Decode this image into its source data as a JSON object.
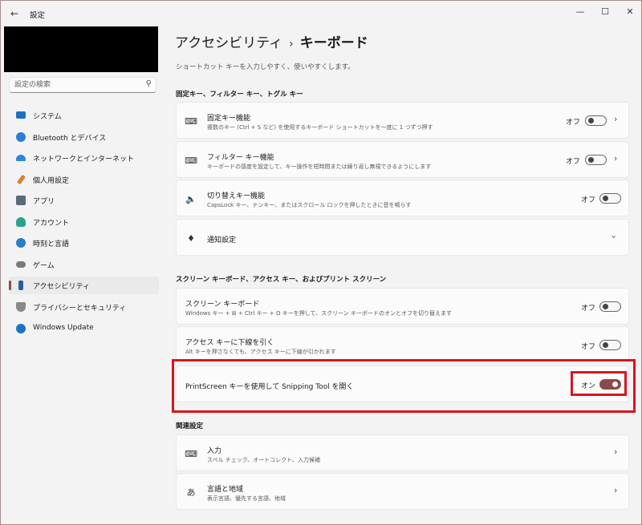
{
  "window": {
    "title": "設定",
    "controls": [
      "minimize",
      "maximize",
      "close"
    ]
  },
  "sidebar": {
    "search": {
      "placeholder": "設定の検索"
    },
    "items": [
      {
        "label": "システム",
        "icon": "monitor-icon",
        "color": "#1c6fc4"
      },
      {
        "label": "Bluetooth とデバイス",
        "icon": "bluetooth-icon",
        "color": "#2a7fd4"
      },
      {
        "label": "ネットワークとインターネット",
        "icon": "wifi-icon",
        "color": "#2c86d6"
      },
      {
        "label": "個人用設定",
        "icon": "brush-icon",
        "color": "#d7822e"
      },
      {
        "label": "アプリ",
        "icon": "apps-icon",
        "color": "#5a6a7a"
      },
      {
        "label": "アカウント",
        "icon": "person-icon",
        "color": "#2aa38e"
      },
      {
        "label": "時刻と言語",
        "icon": "globe-clock-icon",
        "color": "#2b7cc9"
      },
      {
        "label": "ゲーム",
        "icon": "gamepad-icon",
        "color": "#7a7a7a"
      },
      {
        "label": "アクセシビリティ",
        "icon": "accessibility-icon",
        "color": "#2c5e9e",
        "active": true
      },
      {
        "label": "プライバシーとセキュリティ",
        "icon": "shield-icon",
        "color": "#8a8a8a"
      },
      {
        "label": "Windows Update",
        "icon": "update-icon",
        "color": "#1a73c7"
      }
    ]
  },
  "main": {
    "breadcrumb": {
      "parent": "アクセシビリティ",
      "separator": "›",
      "current": "キーボード"
    },
    "description": "ショートカット キーを入力しやすく、使いやすくします。",
    "sections": [
      {
        "heading": "固定キー、フィルター キー、トグル キー",
        "cards": [
          {
            "title": "固定キー機能",
            "subtitle": "複数のキー (Ctrl + S など) を使用するキーボード ショートカットを一度に 1 つずつ押す",
            "state": "オフ",
            "on": false,
            "chevron": true,
            "icon": "sticky-keys-icon"
          },
          {
            "title": "フィルター キー機能",
            "subtitle": "キーボードの感度を設定して、キー操作を短時間または繰り返し無視できるようにします",
            "state": "オフ",
            "on": false,
            "chevron": true,
            "icon": "filter-keys-icon"
          },
          {
            "title": "切り替えキー機能",
            "subtitle": "CapsLock キー、テンキー、またはスクロール ロックを押したときに音を鳴らす",
            "state": "オフ",
            "on": false,
            "chevron": false,
            "icon": "speaker-icon"
          },
          {
            "title": "通知設定",
            "expandable": true,
            "icon": "bell-icon"
          }
        ]
      },
      {
        "heading": "スクリーン キーボード、アクセス キー、およびプリント スクリーン",
        "cards": [
          {
            "title": "スクリーン キーボード",
            "subtitle": "Windows キー + ⊞ + Ctrl キー + O キーを押して、スクリーン キーボードのオンとオフを切り替えます",
            "state": "オフ",
            "on": false
          },
          {
            "title": "アクセス キーに下線を引く",
            "subtitle": "Alt キーを押さなくても、アクセス キーに下線が引かれます",
            "state": "オフ",
            "on": false
          },
          {
            "title": "PrintScreen キーを使用して Snipping Tool を開く",
            "state": "オン",
            "on": true
          }
        ]
      },
      {
        "heading": "関連設定",
        "cards": [
          {
            "title": "入力",
            "subtitle": "スペル チェック、オートコレクト、入力候補",
            "icon": "keyboard-icon"
          },
          {
            "title": "言語と地域",
            "subtitle": "表示言語、優先する言語、地域",
            "icon": "language-icon"
          }
        ]
      }
    ]
  },
  "accent_color": "#8b4a4a",
  "highlight_color": "#d9151f"
}
